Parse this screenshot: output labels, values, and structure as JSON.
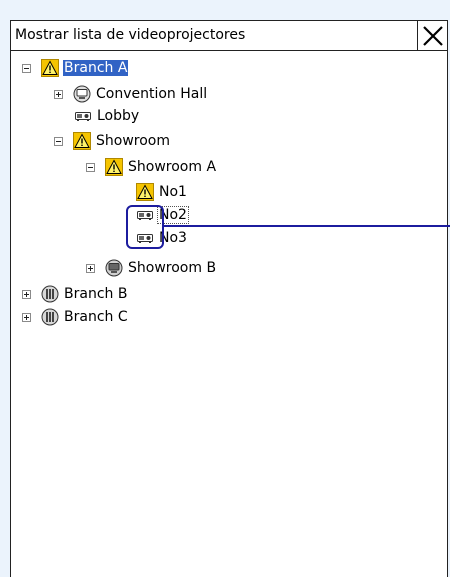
{
  "window": {
    "title": "Mostrar lista de videoprojectores"
  },
  "icons": {
    "warning": "warning-icon",
    "projector": "projector-icon",
    "monitor_group": "monitor-group-icon",
    "network_group": "network-group-icon",
    "close": "close-icon"
  },
  "colors": {
    "background": "#ebf3fc",
    "selection": "#3163c5",
    "warning": "#f5c400",
    "callout": "#1c1c9e"
  },
  "tree": {
    "branch_a": "Branch A",
    "convention_hall": "Convention Hall",
    "lobby": "Lobby",
    "showroom": "Showroom",
    "showroom_a": "Showroom A",
    "no1": "No1",
    "no2": "No2",
    "no3": "No3",
    "showroom_b": "Showroom B",
    "branch_b": "Branch B",
    "branch_c": "Branch C"
  }
}
